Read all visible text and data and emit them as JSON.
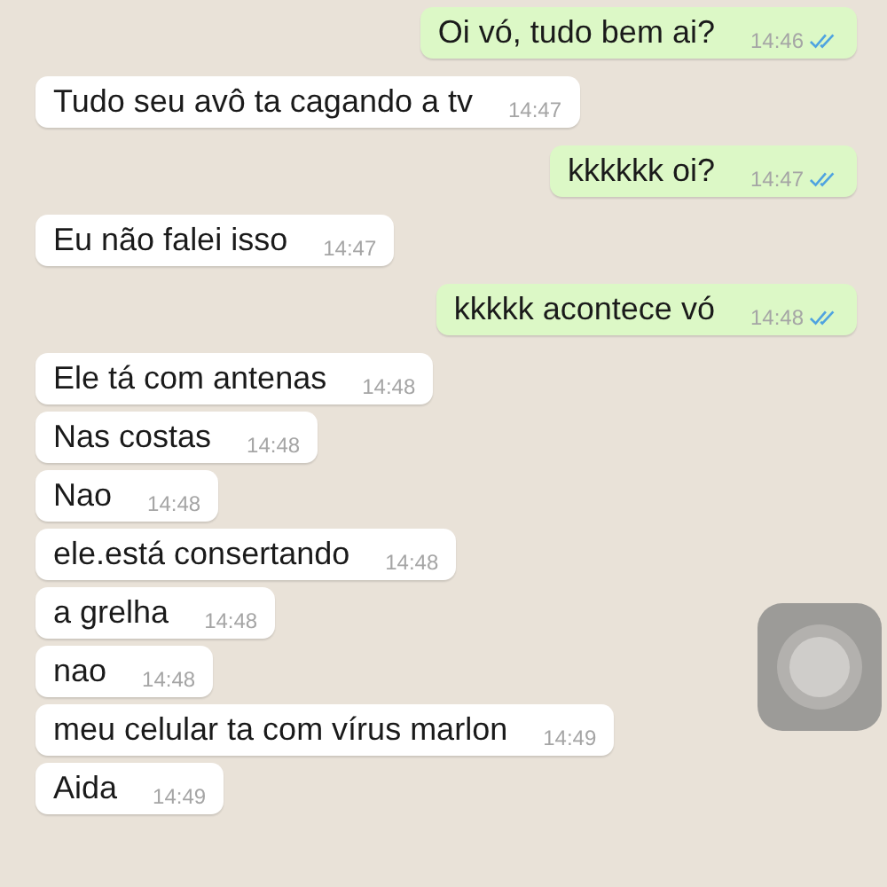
{
  "messages": [
    {
      "kind": "sent",
      "text": "Oi vó, tudo bem ai?",
      "time": "14:46",
      "read": true
    },
    {
      "kind": "received",
      "text": "Tudo seu avô ta cagando a tv",
      "time": "14:47"
    },
    {
      "kind": "sent",
      "text": "kkkkkk oi?",
      "time": "14:47",
      "read": true
    },
    {
      "kind": "received",
      "text": "Eu não falei isso",
      "time": "14:47"
    },
    {
      "kind": "sent",
      "text": "kkkkk acontece vó",
      "time": "14:48",
      "read": true
    },
    {
      "kind": "received",
      "text": "Ele tá com antenas",
      "time": "14:48"
    },
    {
      "kind": "received",
      "text": "Nas costas",
      "time": "14:48"
    },
    {
      "kind": "received",
      "text": "Nao",
      "time": "14:48"
    },
    {
      "kind": "received",
      "text": "ele.está consertando",
      "time": "14:48"
    },
    {
      "kind": "received",
      "text": "a grelha",
      "time": "14:48"
    },
    {
      "kind": "received",
      "text": "nao",
      "time": "14:48"
    },
    {
      "kind": "received",
      "text": "meu celular ta com vírus marlon",
      "time": "14:49"
    },
    {
      "kind": "received",
      "text": "Aida",
      "time": "14:49"
    }
  ]
}
